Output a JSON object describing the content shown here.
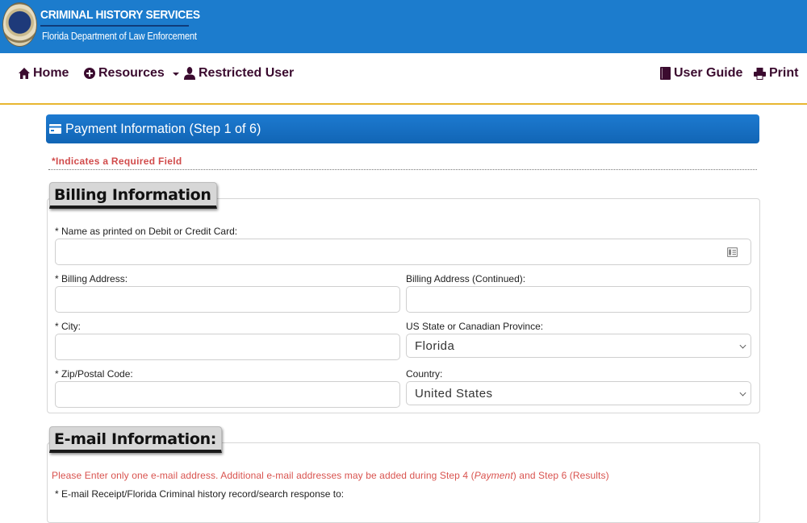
{
  "banner": {
    "title": "CRIMINAL HISTORY SERVICES",
    "subtitle": "Florida Department of Law Enforcement",
    "logo": "fdle-seal"
  },
  "nav": {
    "left": [
      {
        "label": "Home",
        "icon": "home-icon"
      },
      {
        "label": "Resources",
        "icon": "plus-circle-icon",
        "dropdown": true
      },
      {
        "label": "Restricted User",
        "icon": "user-icon"
      }
    ],
    "right": [
      {
        "label": "User Guide",
        "icon": "book-icon"
      },
      {
        "label": "Print",
        "icon": "print-icon"
      }
    ]
  },
  "payment_header": {
    "title": "Payment Information (Step 1 of 6)",
    "icon": "credit-card-icon"
  },
  "required_note": "*Indicates a Required Field",
  "billing": {
    "legend": "Billing Information",
    "fields": {
      "card_name": {
        "label": "* Name as printed on Debit or Credit Card:",
        "value": ""
      },
      "address": {
        "label": "* Billing Address:",
        "value": ""
      },
      "address2": {
        "label": "Billing Address (Continued):",
        "value": ""
      },
      "city": {
        "label": "* City:",
        "value": ""
      },
      "state": {
        "label": "US State or Canadian Province:",
        "selected": "Florida"
      },
      "zip": {
        "label": "* Zip/Postal Code:",
        "value": ""
      },
      "country": {
        "label": "Country:",
        "selected": "United States"
      }
    }
  },
  "email": {
    "legend": "E-mail Information:",
    "note_before": "Please Enter only one e-mail address. Additional e-mail addresses may be added during Step 4 (",
    "note_italic": "Payment",
    "note_after": ") and Step 6 (Results)",
    "field_label": "* E-mail Receipt/Florida Criminal history record/search response to:"
  }
}
